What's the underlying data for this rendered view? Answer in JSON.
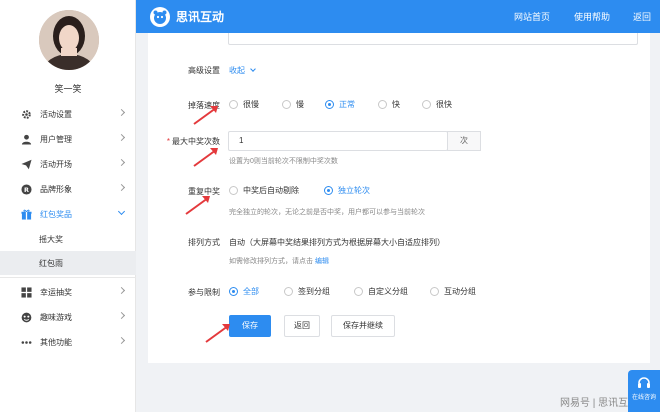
{
  "sidebar": {
    "username": "笑一笑",
    "items": [
      {
        "label": "活动设置",
        "icon": "gear-icon"
      },
      {
        "label": "用户管理",
        "icon": "user-icon"
      },
      {
        "label": "活动开场",
        "icon": "send-icon"
      },
      {
        "label": "品牌形象",
        "icon": "registered-icon"
      },
      {
        "label": "红包奖品",
        "icon": "gift-icon"
      },
      {
        "label": "幸运抽奖",
        "icon": "grid-icon"
      },
      {
        "label": "趣味游戏",
        "icon": "game-icon"
      },
      {
        "label": "其他功能",
        "icon": "more-icon"
      }
    ],
    "submenu": [
      {
        "label": "摇大奖"
      },
      {
        "label": "红包雨"
      }
    ]
  },
  "header": {
    "logo_text": "思讯互动",
    "links": [
      "网站首页",
      "使用帮助",
      "返回"
    ]
  },
  "form": {
    "advanced": {
      "label": "高级设置",
      "toggle": "收起"
    },
    "speed": {
      "label": "掉落速度",
      "options": [
        "很慢",
        "慢",
        "正常",
        "快",
        "很快"
      ],
      "selected": "正常"
    },
    "max_wins": {
      "label": "最大中奖次数",
      "value": "1",
      "suffix": "次",
      "hint": "设置为0则当前轮次不限制中奖次数"
    },
    "repeat": {
      "label": "重复中奖",
      "options": [
        "中奖后自动剔除",
        "独立轮次"
      ],
      "selected": "独立轮次",
      "hint": "完全独立的轮次，无论之前是否中奖，用户都可以参与当前轮次"
    },
    "sort": {
      "label": "排列方式",
      "value": "自动（大屏幕中奖结果排列方式为根据屏幕大小自适应排列）",
      "hint": "如需修改排列方式，请点击",
      "edit": "编辑"
    },
    "participate": {
      "label": "参与限制",
      "options": [
        "全部",
        "签到分组",
        "自定义分组",
        "互动分组"
      ],
      "selected": "全部"
    }
  },
  "buttons": {
    "save": "保存",
    "back": "返回",
    "save_continue": "保存并继续"
  },
  "watermark": "网易号 | 思讯互动",
  "float_button": {
    "label": "在线咨询"
  },
  "colors": {
    "accent": "#2d8cf0",
    "annotation_arrow": "#e4393c"
  }
}
